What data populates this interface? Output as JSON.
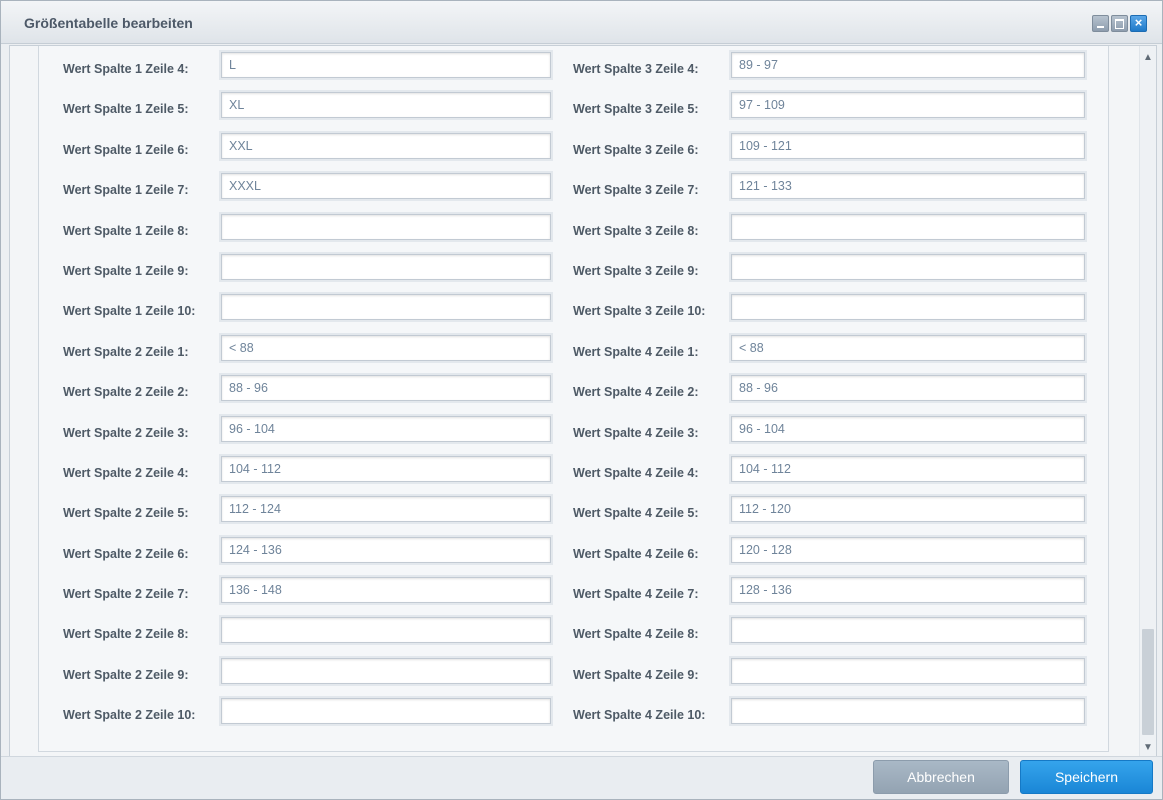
{
  "window": {
    "title": "Größentabelle bearbeiten"
  },
  "icons": {
    "minimize": "minimize-icon",
    "maximize": "maximize-icon",
    "close": "close-icon",
    "scroll_up": "chevron-up-icon",
    "scroll_down": "chevron-down-icon"
  },
  "colors": {
    "accent": "#1f86d6",
    "secondary_button": "#9eadbc",
    "label": "#4e5a66",
    "input_text": "#6f849a"
  },
  "form": {
    "left": [
      {
        "label": "Wert Spalte 1 Zeile 4:",
        "value": "L"
      },
      {
        "label": "Wert Spalte 1 Zeile 5:",
        "value": "XL"
      },
      {
        "label": "Wert Spalte 1 Zeile 6:",
        "value": "XXL"
      },
      {
        "label": "Wert Spalte 1 Zeile 7:",
        "value": "XXXL"
      },
      {
        "label": "Wert Spalte 1 Zeile 8:",
        "value": ""
      },
      {
        "label": "Wert Spalte 1 Zeile 9:",
        "value": ""
      },
      {
        "label": "Wert Spalte 1 Zeile 10:",
        "value": ""
      },
      {
        "label": "Wert Spalte 2 Zeile 1:",
        "value": "< 88"
      },
      {
        "label": "Wert Spalte 2 Zeile 2:",
        "value": "88 - 96"
      },
      {
        "label": "Wert Spalte 2 Zeile 3:",
        "value": "96 - 104"
      },
      {
        "label": "Wert Spalte 2 Zeile 4:",
        "value": "104 - 112"
      },
      {
        "label": "Wert Spalte 2 Zeile 5:",
        "value": "112 - 124"
      },
      {
        "label": "Wert Spalte 2 Zeile 6:",
        "value": "124 - 136"
      },
      {
        "label": "Wert Spalte 2 Zeile 7:",
        "value": "136 - 148"
      },
      {
        "label": "Wert Spalte 2 Zeile 8:",
        "value": ""
      },
      {
        "label": "Wert Spalte 2 Zeile 9:",
        "value": ""
      },
      {
        "label": "Wert Spalte 2 Zeile 10:",
        "value": ""
      }
    ],
    "right": [
      {
        "label": "Wert Spalte 3 Zeile 4:",
        "value": "89 - 97"
      },
      {
        "label": "Wert Spalte 3 Zeile 5:",
        "value": "97 - 109"
      },
      {
        "label": "Wert Spalte 3 Zeile 6:",
        "value": "109 - 121"
      },
      {
        "label": "Wert Spalte 3 Zeile 7:",
        "value": "121 - 133"
      },
      {
        "label": "Wert Spalte 3 Zeile 8:",
        "value": ""
      },
      {
        "label": "Wert Spalte 3 Zeile 9:",
        "value": ""
      },
      {
        "label": "Wert Spalte 3 Zeile 10:",
        "value": ""
      },
      {
        "label": "Wert Spalte 4 Zeile 1:",
        "value": "< 88"
      },
      {
        "label": "Wert Spalte 4 Zeile 2:",
        "value": "88 - 96"
      },
      {
        "label": "Wert Spalte 4 Zeile 3:",
        "value": "96 - 104"
      },
      {
        "label": "Wert Spalte 4 Zeile 4:",
        "value": "104 - 112"
      },
      {
        "label": "Wert Spalte 4 Zeile 5:",
        "value": "112 - 120"
      },
      {
        "label": "Wert Spalte 4 Zeile 6:",
        "value": "120 - 128"
      },
      {
        "label": "Wert Spalte 4 Zeile 7:",
        "value": "128 - 136"
      },
      {
        "label": "Wert Spalte 4 Zeile 8:",
        "value": ""
      },
      {
        "label": "Wert Spalte 4 Zeile 9:",
        "value": ""
      },
      {
        "label": "Wert Spalte 4 Zeile 10:",
        "value": ""
      }
    ]
  },
  "footer": {
    "cancel_label": "Abbrechen",
    "save_label": "Speichern"
  }
}
